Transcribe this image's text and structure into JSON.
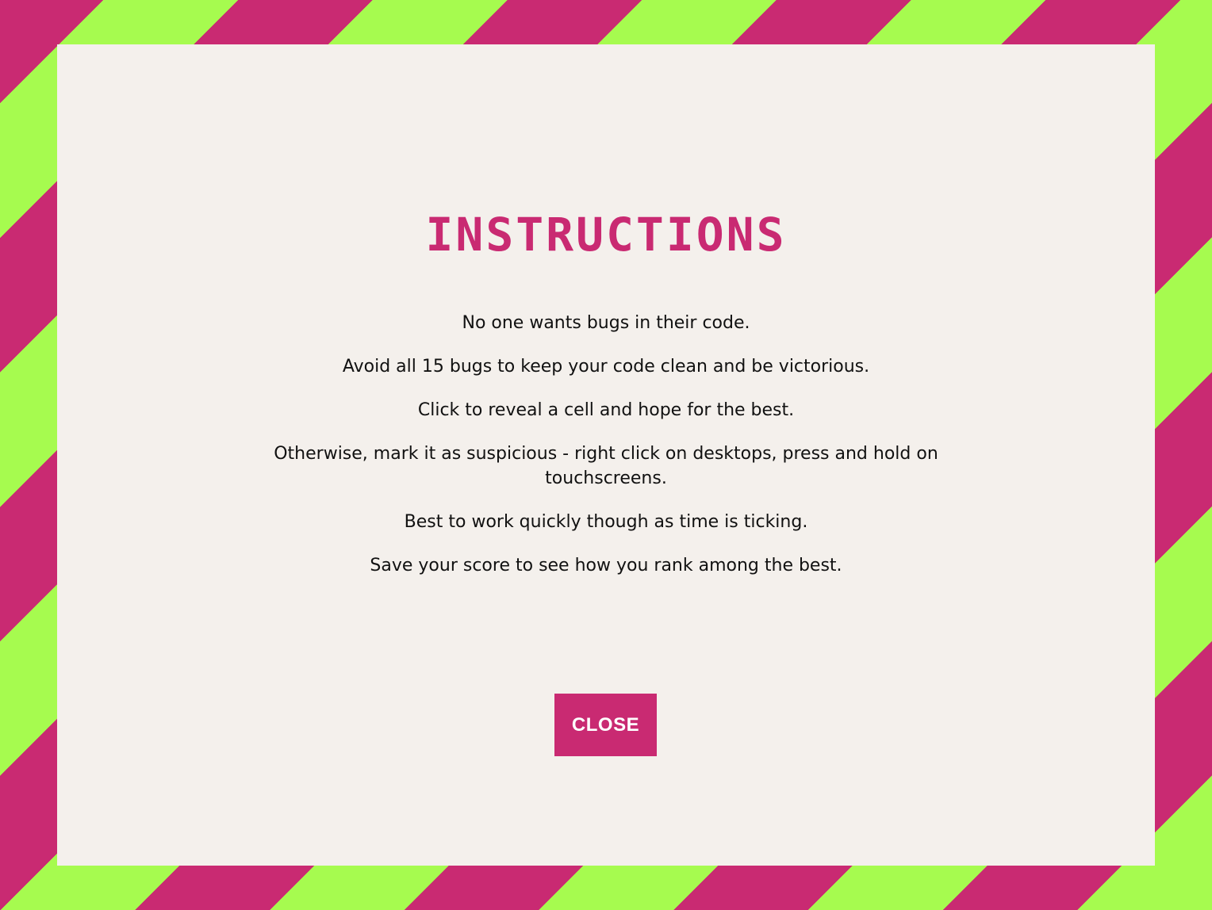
{
  "dialog": {
    "title": "INSTRUCTIONS",
    "lines": [
      "No one wants bugs in their code.",
      "Avoid all 15 bugs to keep your code clean and be victorious.",
      "Click to reveal a cell and hope for the best.",
      "Otherwise, mark it as suspicious - right click on desktops, press and hold on touchscreens.",
      "Best to work quickly though as time is ticking.",
      "Save your score to see how you rank among the best."
    ],
    "close_label": "CLOSE"
  },
  "colors": {
    "accent": "#c92a72",
    "stripe_green": "#a6fb4f",
    "panel_bg": "#f4f0ec"
  }
}
